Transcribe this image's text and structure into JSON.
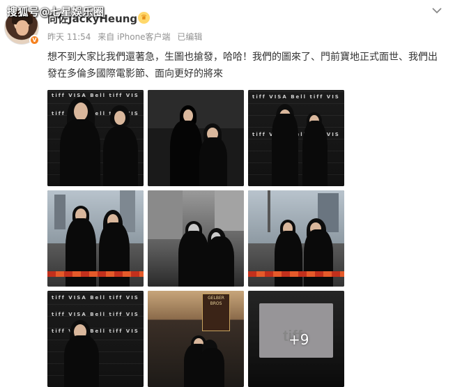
{
  "watermark": "搜狐号@七星娛乐圈",
  "user": {
    "name": "向佐JackyHeung",
    "verified_badge": "V",
    "crown_icon": "crown-icon"
  },
  "meta": {
    "time": "昨天 11:54",
    "source": "来自 iPhone客户端",
    "edited": "已编辑"
  },
  "post": {
    "text": "想不到大家比我們還著急，生圖也搶發，哈哈！我們的圖來了、門前寶地正式面世、我們出發在多倫多國際電影節、面向更好的將來"
  },
  "photos": {
    "backdrop_logos": "tiff VISA Bell tiff VISA Bell",
    "tiff_logo": "tiff",
    "more_label": "+9",
    "store_sign": "GELBER BROS"
  },
  "colors": {
    "meta_gray": "#939393",
    "badge_orange": "#f58220",
    "text": "#333333"
  }
}
